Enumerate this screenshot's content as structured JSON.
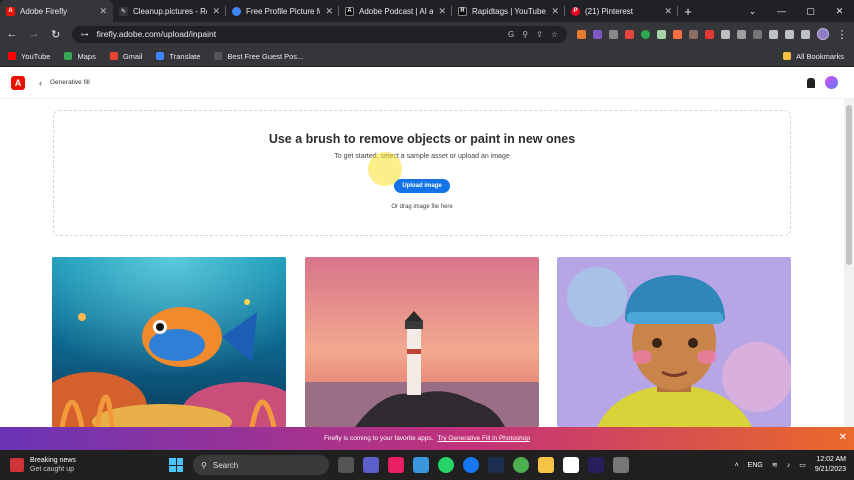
{
  "browser": {
    "tabs": [
      {
        "label": "Adobe Firefly",
        "icon": "adobe-icon",
        "color": "#eb1000",
        "active": true
      },
      {
        "label": "Cleanup.pictures - Re",
        "icon": "pen-icon",
        "color": "#ffffff"
      },
      {
        "label": "Free Profile Picture M",
        "icon": "profile-icon",
        "color": "#4285f4"
      },
      {
        "label": "Adobe Podcast | AI au",
        "icon": "podcast-icon",
        "color": "#111111"
      },
      {
        "label": "Rapidtags | YouTube T",
        "icon": "tag-icon",
        "color": "#111111"
      },
      {
        "label": "(21) Pinterest",
        "icon": "pinterest-icon",
        "color": "#e60023"
      }
    ],
    "url": "firefly.adobe.com/upload/inpaint",
    "bookmarks": [
      {
        "label": "YouTube",
        "color": "#ff0000"
      },
      {
        "label": "Maps",
        "color": "#34a853"
      },
      {
        "label": "Gmail",
        "color": "#ea4335"
      },
      {
        "label": "Translate",
        "color": "#4285f4"
      },
      {
        "label": "Best Free Guest Pos...",
        "color": "#555555"
      }
    ],
    "all_bookmarks": "All Bookmarks"
  },
  "app": {
    "breadcrumb": "Generative fill",
    "title": "Use a brush to remove objects or paint in new ones",
    "subtitle": "To get started, select a sample asset or upload an image",
    "upload_label": "Upload image",
    "drag_hint": "Or drag image file here"
  },
  "promo": {
    "text": "Firefly is coming to your favorite apps.",
    "link": "Try Generative Fill in Photoshop"
  },
  "taskbar": {
    "news_title": "Breaking news",
    "news_sub": "Get caught up",
    "search_placeholder": "Search",
    "language": "ENG",
    "time": "12:02 AM",
    "date": "9/21/2023"
  }
}
